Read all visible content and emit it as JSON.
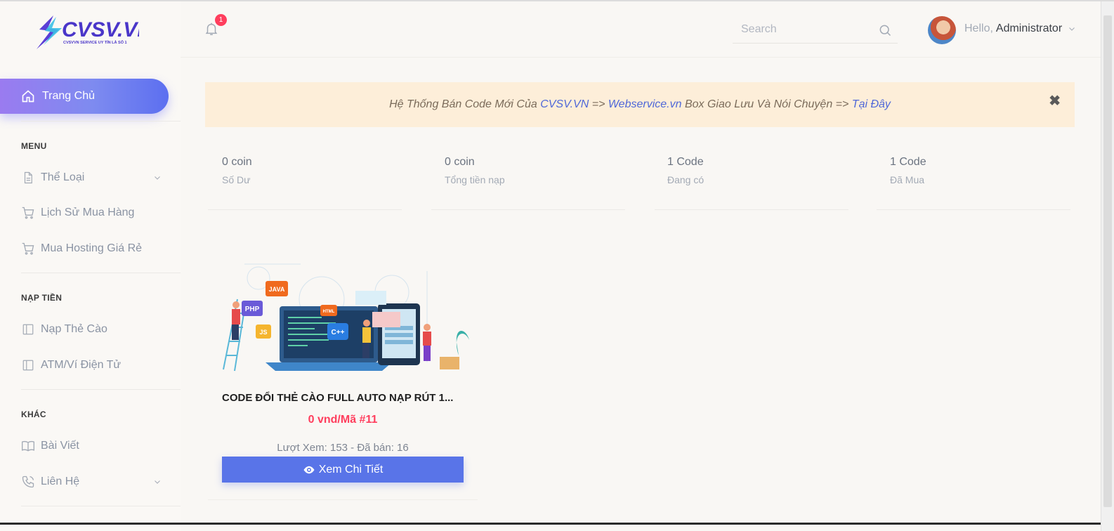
{
  "brand": {
    "logo_text": "CVSV.VN",
    "tagline": "CVSVVN SERVICE UY TÍN LÀ SỐ 1",
    "accent": "#5974e8"
  },
  "sidebar": {
    "home_label": "Trang Chủ",
    "sections": [
      {
        "title": "MENU",
        "items": [
          {
            "label": "Thể Loại",
            "icon": "file-icon",
            "has_children": true
          },
          {
            "label": "Lịch Sử Mua Hàng",
            "icon": "cart-icon"
          },
          {
            "label": "Mua Hosting Giá Rẻ",
            "icon": "cart-icon"
          }
        ]
      },
      {
        "title": "NẠP TIỀN",
        "items": [
          {
            "label": "Nạp Thẻ Cào",
            "icon": "layout-icon"
          },
          {
            "label": "ATM/Ví Điện Tử",
            "icon": "layout-icon"
          }
        ]
      },
      {
        "title": "KHÁC",
        "items": [
          {
            "label": "Bài Viết",
            "icon": "book-icon"
          },
          {
            "label": "Liên Hệ",
            "icon": "phone-icon",
            "has_children": true
          }
        ]
      }
    ]
  },
  "header": {
    "notification_count": "1",
    "search_placeholder": "Search",
    "hello": "Hello,",
    "user_name": "Administrator"
  },
  "alert": {
    "text1": "Hệ Thống Bán Code Mới Của ",
    "link1": "CVSV.VN",
    "text2": " => ",
    "link2": "Webservice.vn",
    "text3": " Box Giao Lưu Và Nói Chuyện => ",
    "link3": "Tại Đây",
    "close": "✖"
  },
  "stats": [
    {
      "value": "0 coin",
      "label": "Số Dư"
    },
    {
      "value": "0 coin",
      "label": "Tổng tiền nạp"
    },
    {
      "value": "1 Code",
      "label": "Đang có"
    },
    {
      "value": "1 Code",
      "label": "Đã Mua"
    }
  ],
  "product": {
    "title": "CODE ĐỔI THẺ CÀO FULL AUTO NẠP RÚT 1...",
    "price": "0 vnd/Mã #11",
    "views": "Lượt Xem: 153 - Đã bán: 16",
    "button": "Xem Chi Tiết",
    "image_tags": [
      "PHP",
      "JAVA",
      "HTML",
      "JS",
      "C++"
    ]
  }
}
